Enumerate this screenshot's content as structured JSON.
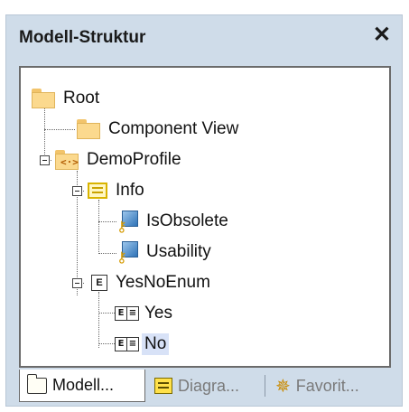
{
  "panel": {
    "title": "Modell-Struktur",
    "close_glyph": "✕"
  },
  "tree": {
    "root": {
      "label": "Root",
      "icon": "folder-icon"
    },
    "component_view": {
      "label": "Component View",
      "icon": "folder-icon"
    },
    "demo_profile": {
      "label": "DemoProfile",
      "icon": "profile-folder-icon",
      "icon_text": "<·>"
    },
    "info": {
      "label": "Info",
      "icon": "stereotype-icon"
    },
    "is_obsolete": {
      "label": "IsObsolete",
      "icon": "property-icon"
    },
    "usability": {
      "label": "Usability",
      "icon": "property-icon"
    },
    "yes_no_enum": {
      "label": "YesNoEnum",
      "icon": "enumeration-icon",
      "icon_text": "E"
    },
    "yes": {
      "label": "Yes",
      "icon": "enum-literal-icon"
    },
    "no": {
      "label": "No",
      "icon": "enum-literal-icon",
      "selected": true
    }
  },
  "tabs": [
    {
      "label": "Modell...",
      "icon": "folder-icon",
      "active": true
    },
    {
      "label": "Diagra...",
      "icon": "diagram-icon",
      "active": false
    },
    {
      "label": "Favorit...",
      "icon": "favorites-icon",
      "active": false
    }
  ],
  "colors": {
    "panel_bg": "#cfdce9",
    "selection": "#d8e2f7",
    "folder": "#fbd98e"
  }
}
